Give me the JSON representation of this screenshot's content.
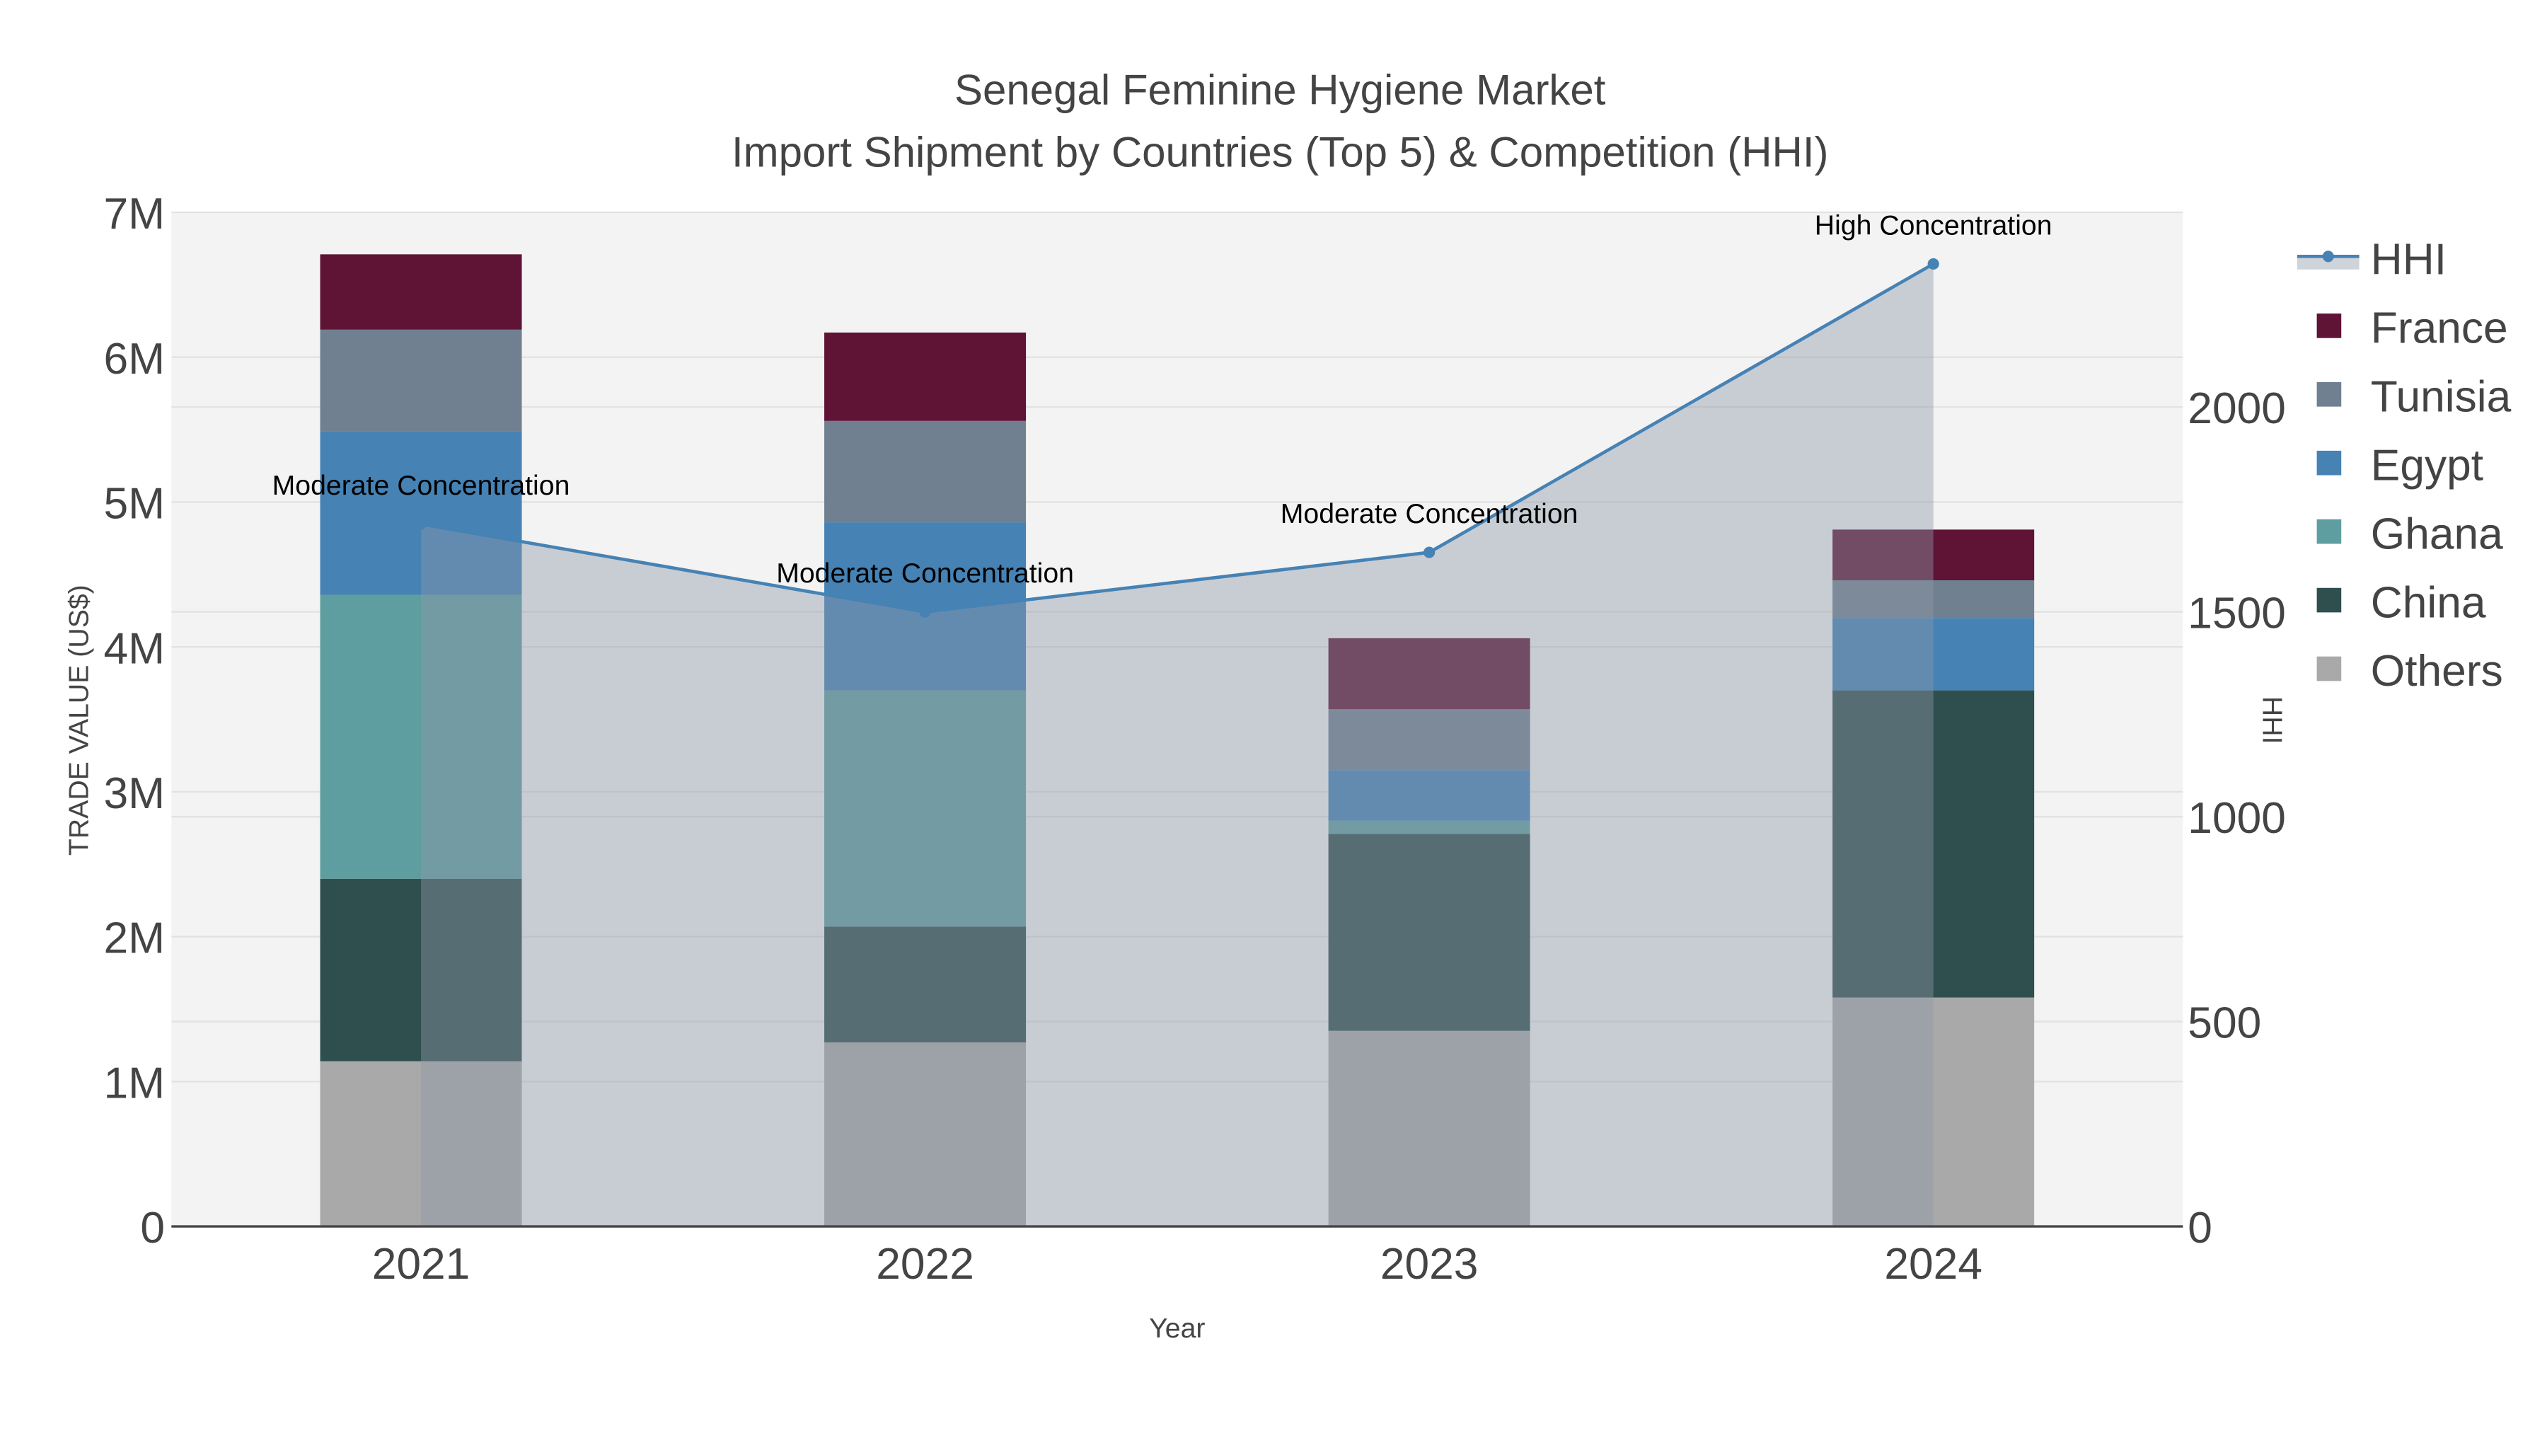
{
  "chart_data": {
    "type": "bar",
    "title": "Senegal Feminine Hygiene Market",
    "subtitle": "Import Shipment by Countries (Top 5) & Competition (HHI)",
    "xlabel": "Year",
    "ylabel": "TRADE VALUE (US$)",
    "y2label": "HHI",
    "categories": [
      "2021",
      "2022",
      "2023",
      "2024"
    ],
    "ylim": [
      0,
      7000000
    ],
    "y2lim": [
      0,
      2475
    ],
    "yticks": [
      0,
      1000000,
      2000000,
      3000000,
      4000000,
      5000000,
      6000000,
      7000000
    ],
    "ytick_labels": [
      "0",
      "1M",
      "2M",
      "3M",
      "4M",
      "5M",
      "6M",
      "7M"
    ],
    "y2ticks": [
      0,
      500,
      1000,
      1500,
      2000
    ],
    "y2tick_labels": [
      "0",
      "500",
      "1000",
      "1500",
      "2000"
    ],
    "barmode": "stack",
    "series": [
      {
        "name": "Others",
        "color": "#a9a9a9",
        "values": [
          1140000,
          1270000,
          1350000,
          1580000
        ]
      },
      {
        "name": "China",
        "color": "#2f4f4f",
        "values": [
          1260000,
          800000,
          1360000,
          2120000
        ]
      },
      {
        "name": "Ghana",
        "color": "#5f9ea0",
        "values": [
          1960000,
          1630000,
          90000,
          0
        ]
      },
      {
        "name": "Egypt",
        "color": "#4682b4",
        "values": [
          1130000,
          1160000,
          350000,
          500000
        ]
      },
      {
        "name": "Tunisia",
        "color": "#708090",
        "values": [
          700000,
          700000,
          420000,
          260000
        ]
      },
      {
        "name": "France",
        "color": "#5f1335",
        "values": [
          520000,
          610000,
          490000,
          350000
        ]
      }
    ],
    "hhi": {
      "name": "HHI",
      "color": "#4682b4",
      "values": [
        1714,
        1500,
        1645,
        2349
      ],
      "annotations": [
        "Moderate Concentration",
        "Moderate Concentration",
        "Moderate Concentration",
        "High Concentration"
      ]
    },
    "legend": [
      "HHI",
      "France",
      "Tunisia",
      "Egypt",
      "Ghana",
      "China",
      "Others"
    ],
    "legend_position": "right",
    "grid": true
  }
}
